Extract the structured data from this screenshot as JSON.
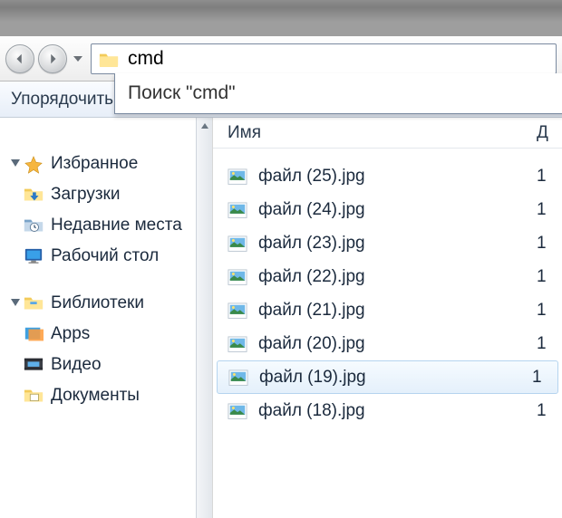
{
  "address": {
    "value": "cmd"
  },
  "suggestion": "Поиск \"cmd\"",
  "toolbar": {
    "organize": "Упорядочить"
  },
  "sidebar": {
    "favorites_label": "Избранное",
    "favorites": [
      {
        "label": "Загрузки"
      },
      {
        "label": "Недавние места"
      },
      {
        "label": "Рабочий стол"
      }
    ],
    "libraries_label": "Библиотеки",
    "libraries": [
      {
        "label": "Apps"
      },
      {
        "label": "Видео"
      },
      {
        "label": "Документы"
      }
    ]
  },
  "columns": {
    "name": "Имя",
    "date_first": "Д"
  },
  "files": [
    {
      "name": "файл (25).jpg",
      "c": "1"
    },
    {
      "name": "файл (24).jpg",
      "c": "1"
    },
    {
      "name": "файл (23).jpg",
      "c": "1"
    },
    {
      "name": "файл (22).jpg",
      "c": "1"
    },
    {
      "name": "файл (21).jpg",
      "c": "1"
    },
    {
      "name": "файл (20).jpg",
      "c": "1"
    },
    {
      "name": "файл (19).jpg",
      "c": "1",
      "selected": true
    },
    {
      "name": "файл (18).jpg",
      "c": "1"
    }
  ]
}
